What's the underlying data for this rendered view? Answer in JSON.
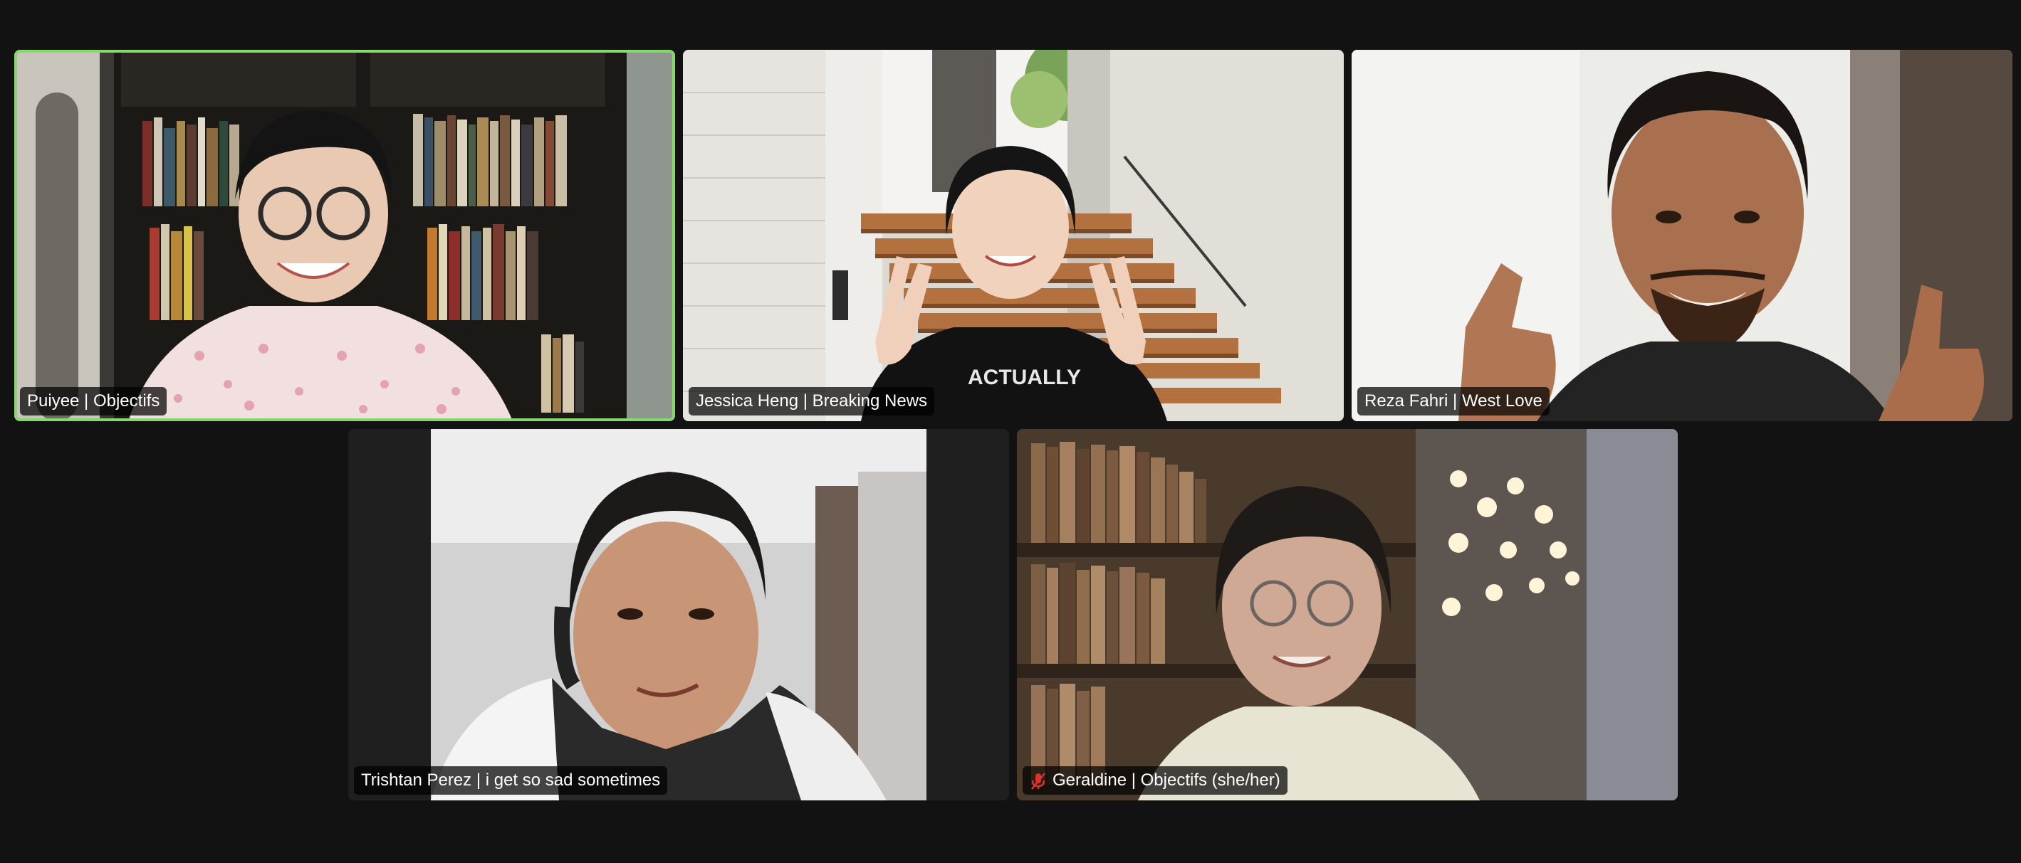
{
  "meeting": {
    "participants": [
      {
        "id": "p1",
        "display_name": "Puiyee | Objectifs",
        "speaking": true,
        "muted": false
      },
      {
        "id": "p2",
        "display_name": "Jessica Heng | Breaking News",
        "speaking": false,
        "muted": false
      },
      {
        "id": "p3",
        "display_name": "Reza Fahri | West Love",
        "speaking": false,
        "muted": false
      },
      {
        "id": "p4",
        "display_name": "Trishtan Perez | i get so sad sometimes",
        "speaking": false,
        "muted": false
      },
      {
        "id": "p5",
        "display_name": "Geraldine | Objectifs (she/her)",
        "speaking": false,
        "muted": true
      }
    ]
  },
  "colors": {
    "background": "#121212",
    "tile_bg": "#1f1f1f",
    "active_speaker_border": "#86d86b",
    "mute_icon": "#e0312c",
    "nametag_text": "#ffffff"
  },
  "icons": {
    "mute": "microphone-muted-icon"
  }
}
